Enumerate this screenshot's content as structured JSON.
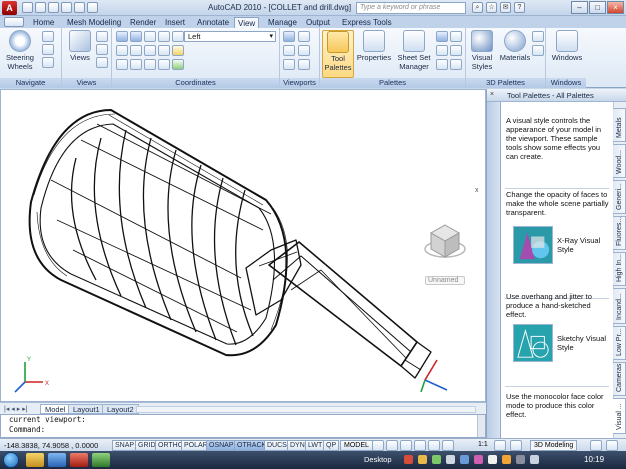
{
  "window": {
    "title": "AutoCAD 2010 - [COLLET and drill.dwg]",
    "search_placeholder": "Type a keyword or phrase",
    "help_icon": "?"
  },
  "ribbon": {
    "tabs": [
      "Home",
      "Mesh Modeling",
      "Render",
      "Insert",
      "Annotate",
      "View",
      "Manage",
      "Output",
      "Express Tools"
    ],
    "active_tab": "View",
    "panels": {
      "navigate": {
        "label": "Navigate",
        "steering": "Steering",
        "wheels": "Wheels"
      },
      "views": {
        "label": "Views",
        "views_btn": "Views"
      },
      "coordinates": {
        "label": "Coordinates",
        "ucs_value": "Left"
      },
      "viewports": {
        "label": "Viewports"
      },
      "palettes": {
        "label": "Palettes",
        "tool_palettes": "Tool",
        "tool_palettes2": "Palettes",
        "properties": "Properties",
        "sheet_set": "Sheet Set",
        "sheet_set2": "Manager"
      },
      "palettes3d": {
        "label": "3D Palettes",
        "visual_styles": "Visual",
        "visual_styles2": "Styles",
        "materials": "Materials"
      },
      "windows": {
        "label": "Windows",
        "windows_btn": "Windows"
      }
    }
  },
  "viewport": {
    "viewcube_label": "Unnamed",
    "close": "x"
  },
  "layouts": {
    "nav": "|◂ ◂ ▸ ▸|",
    "tabs": [
      "Model",
      "Layout1",
      "Layout2"
    ],
    "active": "Model"
  },
  "command": {
    "line1": "current viewport:",
    "line2": "Command:"
  },
  "palette": {
    "title": "Tool Palettes - All Palettes",
    "tabs": [
      "Metals",
      "Wood...",
      "Generi...",
      "Fluores...",
      "High In...",
      "Incand...",
      "Low Pr...",
      "Cameras",
      "Visual ..."
    ],
    "active_tab": "Visual ...",
    "intro": "A visual style controls the appearance of your model in the viewport. These sample tools show some effects you can create.",
    "desc1": "Change the opacity of faces to make the whole scene partially transparent.",
    "item1": "X-Ray Visual Style",
    "desc2": "Use overhang and jitter to produce a hand-sketched effect.",
    "item2": "Sketchy Visual Style",
    "desc3": "Use the monocolor face color mode to produce this color effect."
  },
  "status": {
    "coords": "-148.3838, 74.9058 , 0.0000",
    "buttons": [
      "SNAP",
      "GRID",
      "ORTHO",
      "POLAR",
      "OSNAP",
      "OTRACK",
      "DUCS",
      "DYN",
      "LWT",
      "QP"
    ],
    "on_buttons": [
      "OSNAP",
      "OTRACK"
    ],
    "model": "MODEL",
    "scale": "1:1",
    "workspace": "3D Modeling"
  },
  "taskbar": {
    "desktop": "Desktop",
    "time": "10:19"
  },
  "colors": {
    "accent": "#2d6fc4",
    "ribbon_bg": "#dde8f5",
    "active_tool": "#f7c75a"
  }
}
